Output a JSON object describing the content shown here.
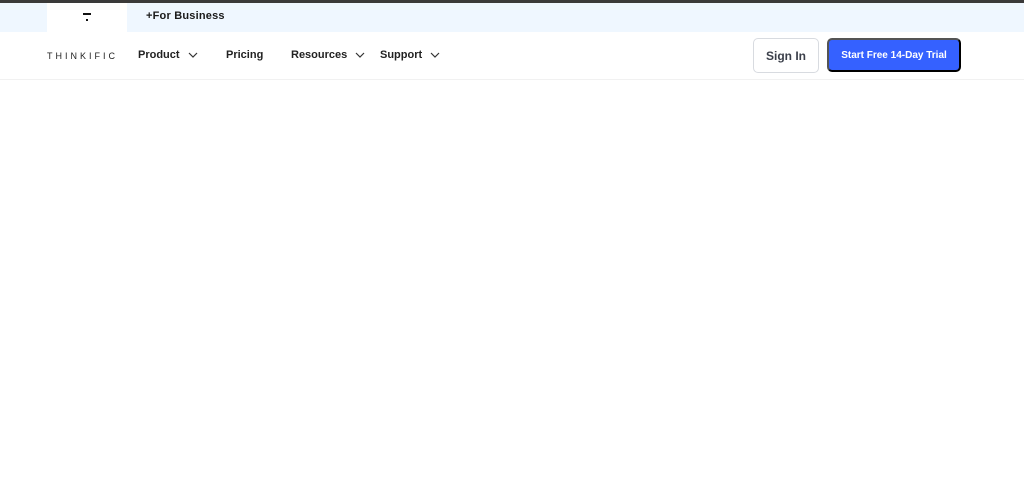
{
  "top_bar": {
    "brand_icon": "thinkific-t-mark-icon",
    "business_link": "+For Business"
  },
  "nav": {
    "logo": "THINKIFIC",
    "items": [
      {
        "label": "Product",
        "has_dropdown": true
      },
      {
        "label": "Pricing",
        "has_dropdown": false
      },
      {
        "label": "Resources",
        "has_dropdown": true
      },
      {
        "label": "Support",
        "has_dropdown": true
      }
    ],
    "sign_in": "Sign In",
    "cta": "Start Free 14-Day Trial"
  },
  "colors": {
    "accent": "#3561ff",
    "subbar_bg": "#eff7ff"
  }
}
